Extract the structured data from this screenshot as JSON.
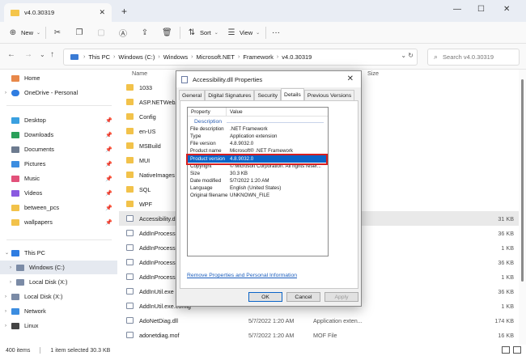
{
  "window": {
    "tab_title": "v4.0.30319",
    "close_tab": "✕",
    "new_tab": "+",
    "minimize": "—",
    "maximize": "☐",
    "close": "✕"
  },
  "toolbar": {
    "new_label": "New",
    "sort_label": "Sort",
    "view_label": "View",
    "more": "···"
  },
  "address": {
    "crumbs": [
      "This PC",
      "Windows (C:)",
      "Windows",
      "Microsoft.NET",
      "Framework",
      "v4.0.30319"
    ],
    "search_placeholder": "Search v4.0.30319"
  },
  "sidebar": {
    "items": [
      {
        "label": "Home",
        "color": "#e8884a"
      },
      {
        "label": "OneDrive - Personal",
        "color": "#2f7de1"
      },
      {
        "label": "Desktop",
        "color": "#3aa0e0"
      },
      {
        "label": "Downloads",
        "color": "#2aa05a"
      },
      {
        "label": "Documents",
        "color": "#6d7b8f"
      },
      {
        "label": "Pictures",
        "color": "#3c8de0"
      },
      {
        "label": "Music",
        "color": "#e2517a"
      },
      {
        "label": "Videos",
        "color": "#8a5ae0"
      },
      {
        "label": "between_pcs",
        "color": "#f2c24a"
      },
      {
        "label": "wallpapers",
        "color": "#f2c24a"
      },
      {
        "label": "This PC",
        "color": "#2f7de1"
      },
      {
        "label": "Windows (C:)",
        "color": "#7b8ba6"
      },
      {
        "label": "Local Disk (X:)",
        "color": "#7b8ba6"
      },
      {
        "label": "Local Disk (X:)",
        "color": "#7b8ba6"
      },
      {
        "label": "Network",
        "color": "#3c8de0"
      },
      {
        "label": "Linux",
        "color": "#444444"
      }
    ]
  },
  "list": {
    "col_name": "Name",
    "col_size": "Size",
    "rows": [
      {
        "name": "1033",
        "kind": "folder",
        "date": "",
        "type": "",
        "size": ""
      },
      {
        "name": "ASP.NETWebAdminFiles",
        "kind": "folder",
        "date": "",
        "type": "",
        "size": ""
      },
      {
        "name": "Config",
        "kind": "folder",
        "date": "",
        "type": "",
        "size": ""
      },
      {
        "name": "en-US",
        "kind": "folder",
        "date": "",
        "type": "",
        "size": ""
      },
      {
        "name": "MSBuild",
        "kind": "folder",
        "date": "",
        "type": "",
        "size": ""
      },
      {
        "name": "MUI",
        "kind": "folder",
        "date": "",
        "type": "",
        "size": ""
      },
      {
        "name": "NativeImages",
        "kind": "folder",
        "date": "",
        "type": "",
        "size": ""
      },
      {
        "name": "SQL",
        "kind": "folder",
        "date": "",
        "type": "",
        "size": ""
      },
      {
        "name": "WPF",
        "kind": "folder",
        "date": "",
        "type": "",
        "size": ""
      },
      {
        "name": "Accessibility.dll",
        "kind": "file",
        "date": "",
        "type": "",
        "size": "31 KB"
      },
      {
        "name": "AddInProcess.exe",
        "kind": "file",
        "date": "",
        "type": "",
        "size": "36 KB"
      },
      {
        "name": "AddInProcess.exe.config",
        "kind": "file",
        "date": "",
        "type": "",
        "size": "1 KB"
      },
      {
        "name": "AddInProcess32.exe",
        "kind": "file",
        "date": "",
        "type": "",
        "size": "36 KB"
      },
      {
        "name": "AddInProcess32.exe.config",
        "kind": "file",
        "date": "",
        "type": "",
        "size": "1 KB"
      },
      {
        "name": "AddInUtil.exe",
        "kind": "file",
        "date": "",
        "type": "",
        "size": "36 KB"
      },
      {
        "name": "AddInUtil.exe.config",
        "kind": "file",
        "date": "",
        "type": "",
        "size": "1 KB"
      },
      {
        "name": "AdoNetDiag.dll",
        "kind": "file",
        "date": "5/7/2022 1:20 AM",
        "type": "Application exten...",
        "size": "174 KB"
      },
      {
        "name": "adonetdiag.mof",
        "kind": "file",
        "date": "5/7/2022 1:20 AM",
        "type": "MOF File",
        "size": "16 KB"
      }
    ]
  },
  "status": {
    "items": "400 items",
    "selected": "1 item selected  30.3 KB"
  },
  "dialog": {
    "title": "Accessibility.dll Properties",
    "close": "✕",
    "tabs": [
      "General",
      "Digital Signatures",
      "Security",
      "Details",
      "Previous Versions"
    ],
    "active_tab": "Details",
    "col_property": "Property",
    "col_value": "Value",
    "group": "Description",
    "rows": [
      {
        "key": "File description",
        "value": ".NET Framework"
      },
      {
        "key": "Type",
        "value": "Application extension"
      },
      {
        "key": "File version",
        "value": "4.8.9032.0"
      },
      {
        "key": "Product name",
        "value": "Microsoft® .NET Framework"
      },
      {
        "key": "Product version",
        "value": "4.8.9032.0"
      },
      {
        "key": "Copyright",
        "value": "© Microsoft Corporation.  All rights reser..."
      },
      {
        "key": "Size",
        "value": "30.3 KB"
      },
      {
        "key": "Date modified",
        "value": "5/7/2022 1:20 AM"
      },
      {
        "key": "Language",
        "value": "English (United States)"
      },
      {
        "key": "Original filename",
        "value": "UNKNOWN_FILE"
      }
    ],
    "remove_link": "Remove Properties and Personal Information",
    "ok": "OK",
    "cancel": "Cancel",
    "apply": "Apply"
  }
}
